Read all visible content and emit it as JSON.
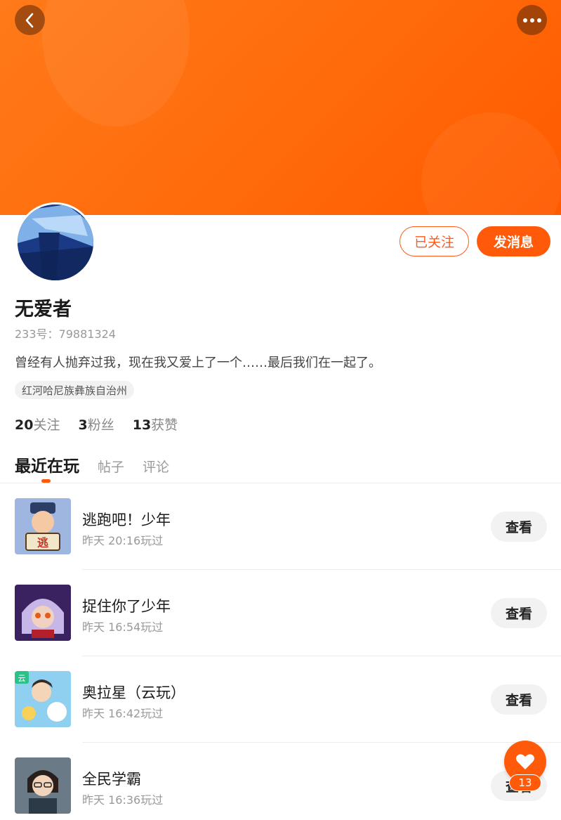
{
  "header": {
    "back_icon": "chevron-left-icon",
    "more_icon": "more-dots-icon"
  },
  "profile": {
    "username": "无爱者",
    "uid": "233号：79881324",
    "bio": "曾经有人抛弃过我，现在我又爱上了一个……最后我们在一起了。",
    "location": "红河哈尼族彝族自治州",
    "followed_label": "已关注",
    "message_label": "发消息"
  },
  "stats": [
    {
      "value": "20",
      "label": "关注"
    },
    {
      "value": "3",
      "label": "粉丝"
    },
    {
      "value": "13",
      "label": "获赞"
    }
  ],
  "tabs": [
    {
      "label": "最近在玩",
      "active": true
    },
    {
      "label": "帖子",
      "active": false
    },
    {
      "label": "评论",
      "active": false
    }
  ],
  "games": [
    {
      "name": "逃跑吧！少年",
      "time": "昨天 20:16玩过",
      "button": "查看"
    },
    {
      "name": "捉住你了少年",
      "time": "昨天 16:54玩过",
      "button": "查看"
    },
    {
      "name": "奥拉星（云玩）",
      "time": "昨天 16:42玩过",
      "button": "查看"
    },
    {
      "name": "全民学霸",
      "time": "昨天 16:36玩过",
      "button": "查看"
    }
  ],
  "like": {
    "icon": "heart-icon",
    "count": "13"
  },
  "colors": {
    "accent": "#ff5a0a",
    "banner": "#ff6a0a"
  }
}
